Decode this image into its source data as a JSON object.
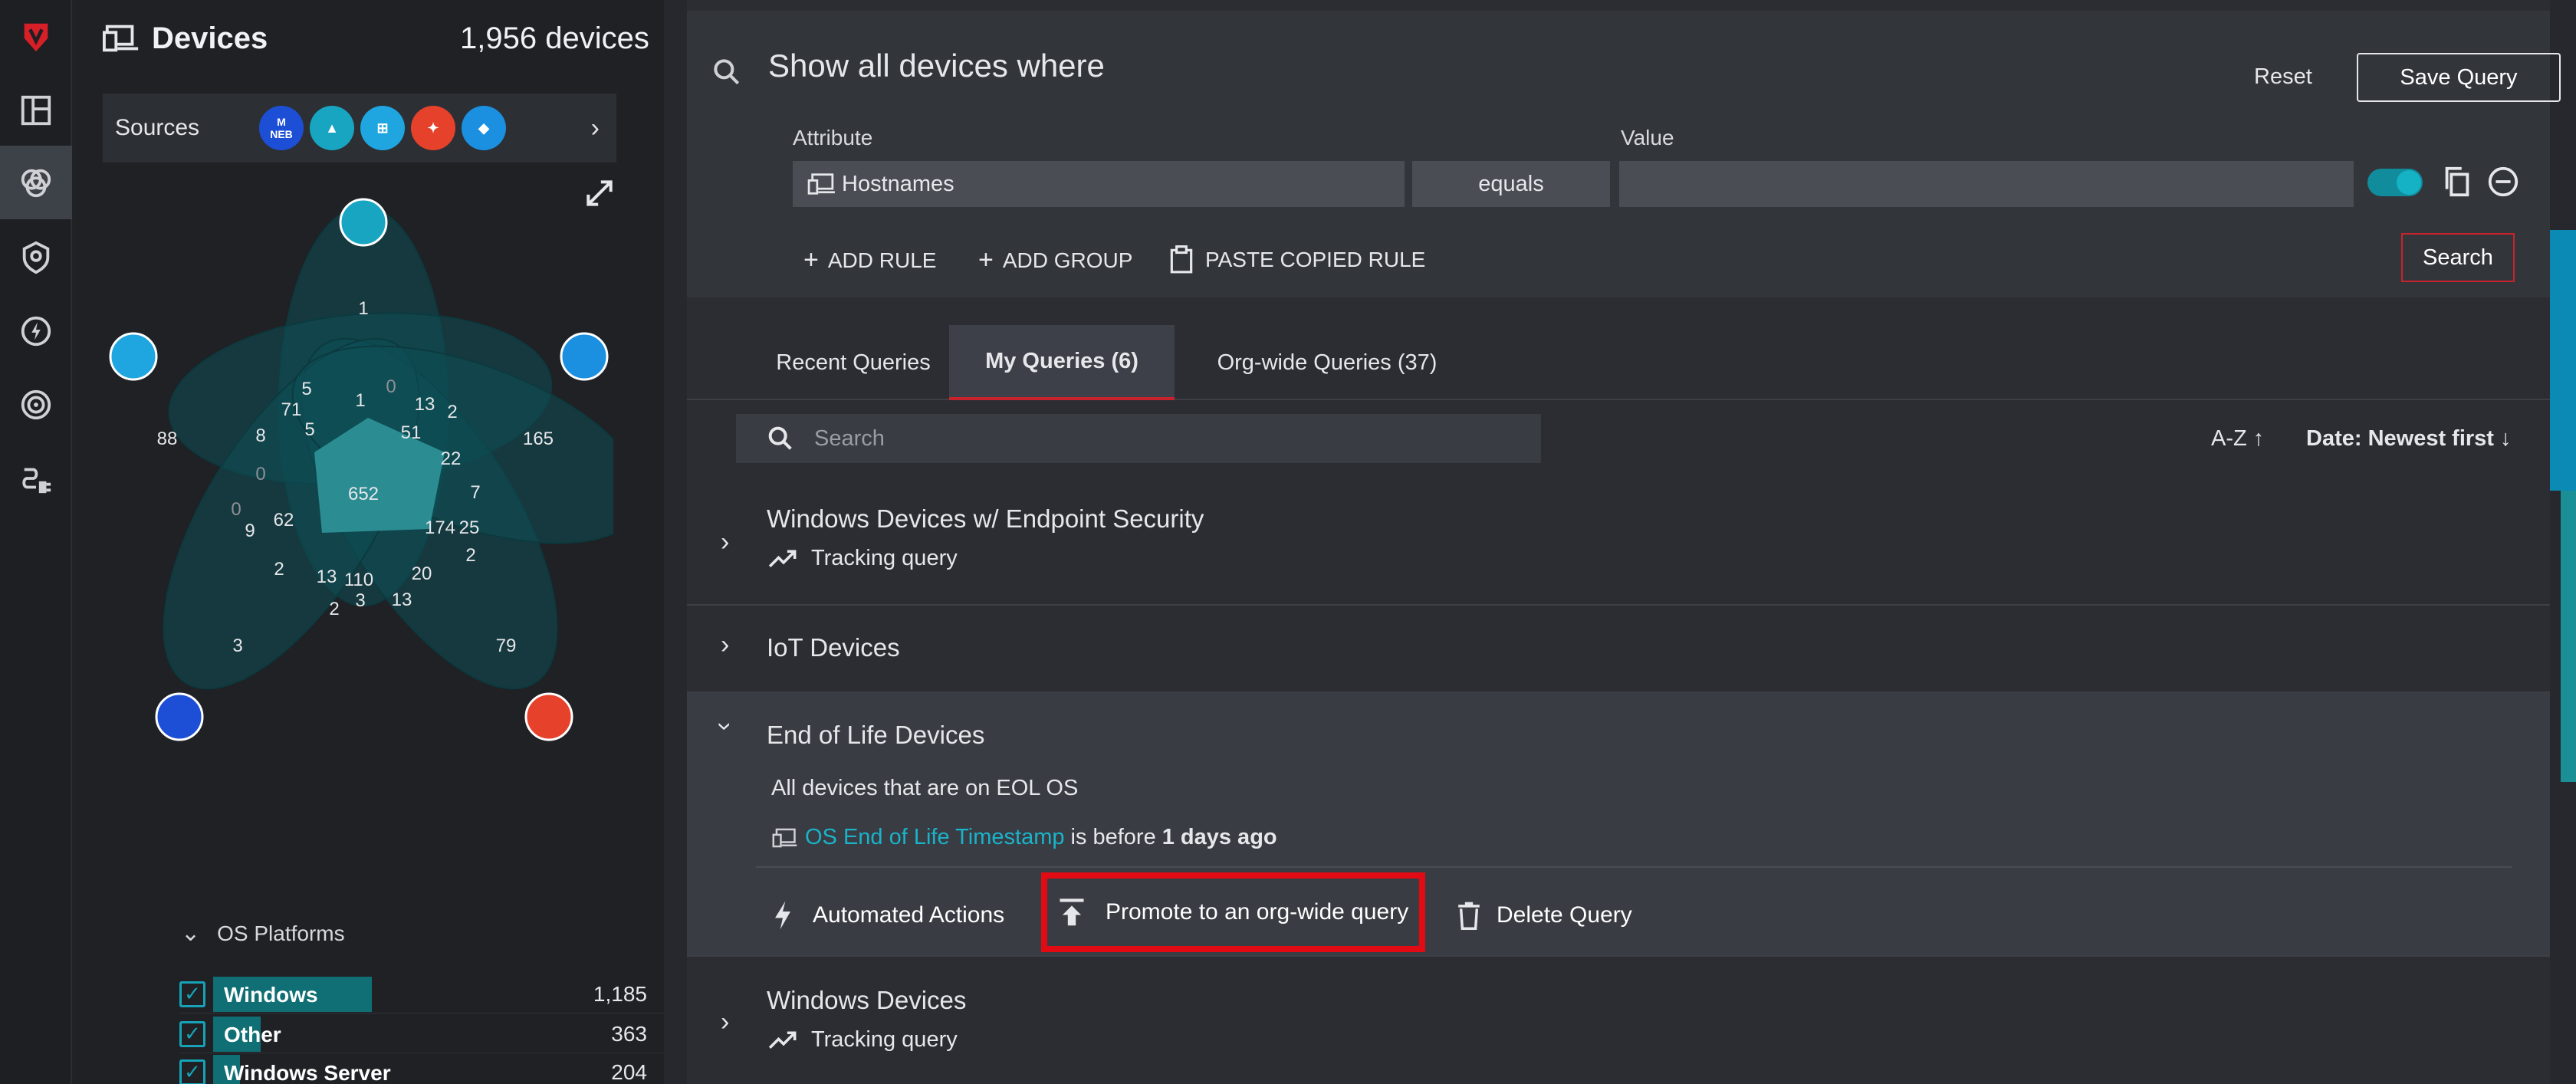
{
  "devices": {
    "title": "Devices",
    "count": "1,956 devices",
    "sources_label": "Sources",
    "sources": [
      "malwarebytes-neb",
      "arctic-wolf",
      "windows",
      "crowdstrike",
      "intune"
    ],
    "source_neb_text": "NEB",
    "venn_numbers": [
      "1",
      "5",
      "71",
      "0",
      "13",
      "2",
      "88",
      "8",
      "5",
      "1",
      "51",
      "165",
      "0",
      "22",
      "652",
      "7",
      "0",
      "9",
      "62",
      "174",
      "25",
      "2",
      "2",
      "13",
      "110",
      "20",
      "3",
      "13",
      "2",
      "3",
      "79"
    ],
    "os_platforms": {
      "title": "OS Platforms",
      "items": [
        {
          "name": "Windows",
          "count": "1,185",
          "fraction": 0.47
        },
        {
          "name": "Other",
          "count": "363",
          "fraction": 0.14
        },
        {
          "name": "Windows Server",
          "count": "204",
          "fraction": 0.08
        }
      ]
    }
  },
  "query_builder": {
    "title": "Show all devices where",
    "reset": "Reset",
    "save": "Save Query",
    "attribute_label": "Attribute",
    "value_label": "Value",
    "attribute_value": "Hostnames",
    "operator": "equals",
    "value": "",
    "add_rule": "ADD RULE",
    "add_group": "ADD GROUP",
    "paste_rule": "PASTE COPIED RULE",
    "search": "Search"
  },
  "tabs": [
    {
      "label": "Recent Queries"
    },
    {
      "label": "My Queries (6)"
    },
    {
      "label": "Org-wide Queries (37)"
    }
  ],
  "list_search_placeholder": "Search",
  "sort": {
    "name": "A-Z",
    "date": "Date: Newest first"
  },
  "queries": [
    {
      "title": "Windows Devices w/ Endpoint Security",
      "sub": "Tracking query"
    },
    {
      "title": "IoT Devices"
    },
    {
      "title": "End of Life Devices",
      "description": "All devices that are on EOL OS",
      "condition_attr": "OS End of Life Timestamp",
      "condition_op": "is before",
      "condition_val": "1 days ago",
      "actions": {
        "automated": "Automated Actions",
        "promote": "Promote to an org-wide query",
        "delete": "Delete Query"
      }
    },
    {
      "title": "Windows Devices",
      "sub": "Tracking query"
    }
  ],
  "colors": {
    "accent": "#14b2c4",
    "brand_red": "#c8232c",
    "highlight": "#e30b13"
  }
}
